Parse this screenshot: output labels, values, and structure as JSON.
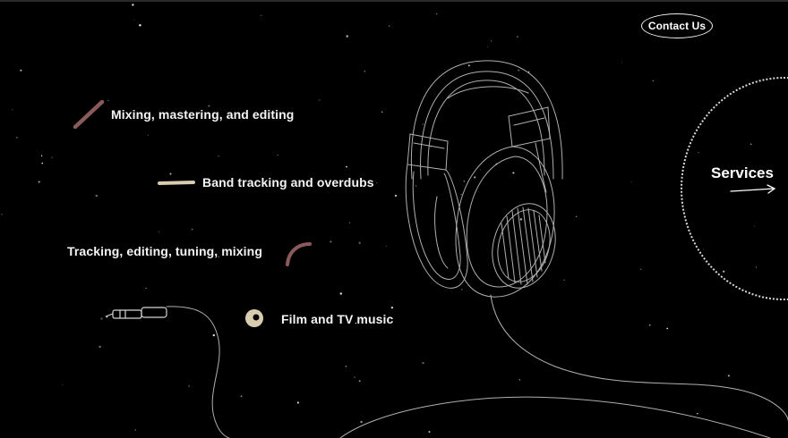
{
  "nav": {
    "contact_label": "Contact Us"
  },
  "services": [
    {
      "label": "Mixing, mastering, and editing",
      "mark": "pink-stroke-mark",
      "color": "#8a5a5a"
    },
    {
      "label": "Band tracking and overdubs",
      "mark": "beige-stroke-mark",
      "color": "#d8cdb0"
    },
    {
      "label": "Tracking, editing, tuning, mixing",
      "mark": "pink-arc-mark",
      "color": "#8a5a5a"
    },
    {
      "label": "Film and TV music",
      "mark": "beige-disc-mark",
      "color": "#d8cdb0"
    }
  ],
  "services_link": {
    "label": "Services",
    "icon": "arrow-right-icon"
  },
  "illustration": {
    "icon": "headphones-illustration",
    "cable_icon": "audio-jack-cable"
  }
}
